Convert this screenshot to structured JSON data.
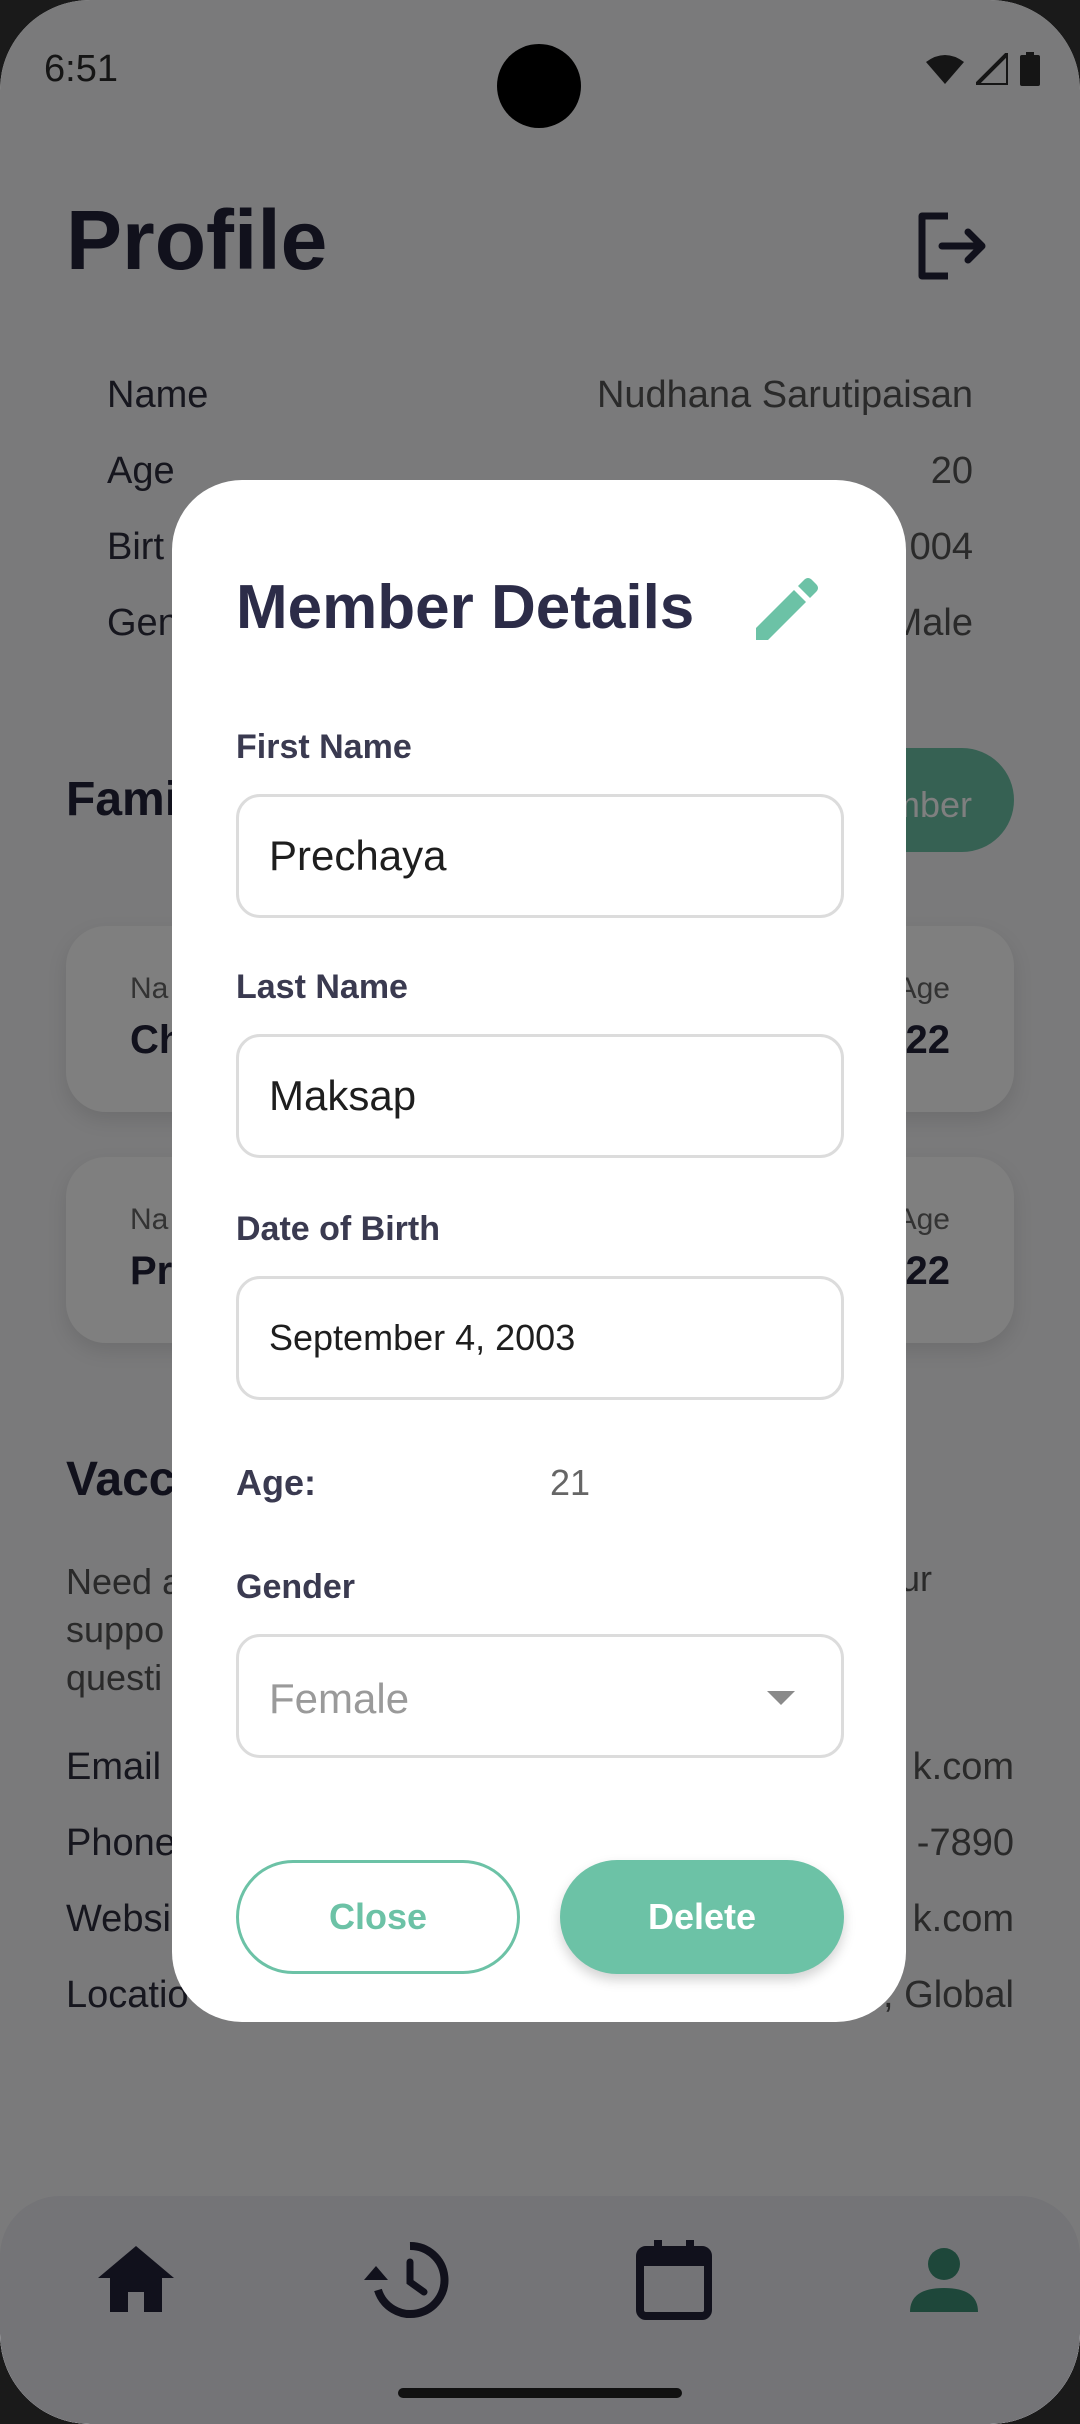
{
  "status": {
    "time": "6:51"
  },
  "profile": {
    "title": "Profile",
    "rows": [
      {
        "label": "Name",
        "value": "Nudhana Sarutipaisan"
      },
      {
        "label": "Age",
        "value": "20"
      },
      {
        "label": "Birt",
        "value": "004"
      },
      {
        "label": "Gen",
        "value": "Male"
      }
    ]
  },
  "family": {
    "title": "Fami",
    "add_button": "mber",
    "members": [
      {
        "name_label": "Na",
        "name": "Ch",
        "age_label": "Age",
        "age": "22"
      },
      {
        "name_label": "Na",
        "name": "Pr",
        "age_label": "Age",
        "age": "22"
      }
    ]
  },
  "vaccine": {
    "title": "Vacc",
    "lines": [
      "Need a",
      "suppo",
      "questi"
    ],
    "trail": "ur"
  },
  "contacts": [
    {
      "label": "Email",
      "value": "k.com"
    },
    {
      "label": "Phone",
      "value": "-7890"
    },
    {
      "label": "Websi",
      "value": "k.com"
    },
    {
      "label": "Locatio",
      "value": ", Global"
    }
  ],
  "nav": [
    "home-icon",
    "history-icon",
    "calendar-icon",
    "profile-icon"
  ],
  "dialog": {
    "title": "Member Details",
    "first_name_label": "First Name",
    "first_name": "Prechaya",
    "last_name_label": "Last Name",
    "last_name": "Maksap",
    "dob_label": "Date of Birth",
    "dob": "September 4, 2003",
    "age_label": "Age:",
    "age": "21",
    "gender_label": "Gender",
    "gender": "Female",
    "close_label": "Close",
    "delete_label": "Delete"
  },
  "colors": {
    "accent": "#6cc2a6",
    "title": "#2c2c48",
    "dark": "#222238"
  }
}
